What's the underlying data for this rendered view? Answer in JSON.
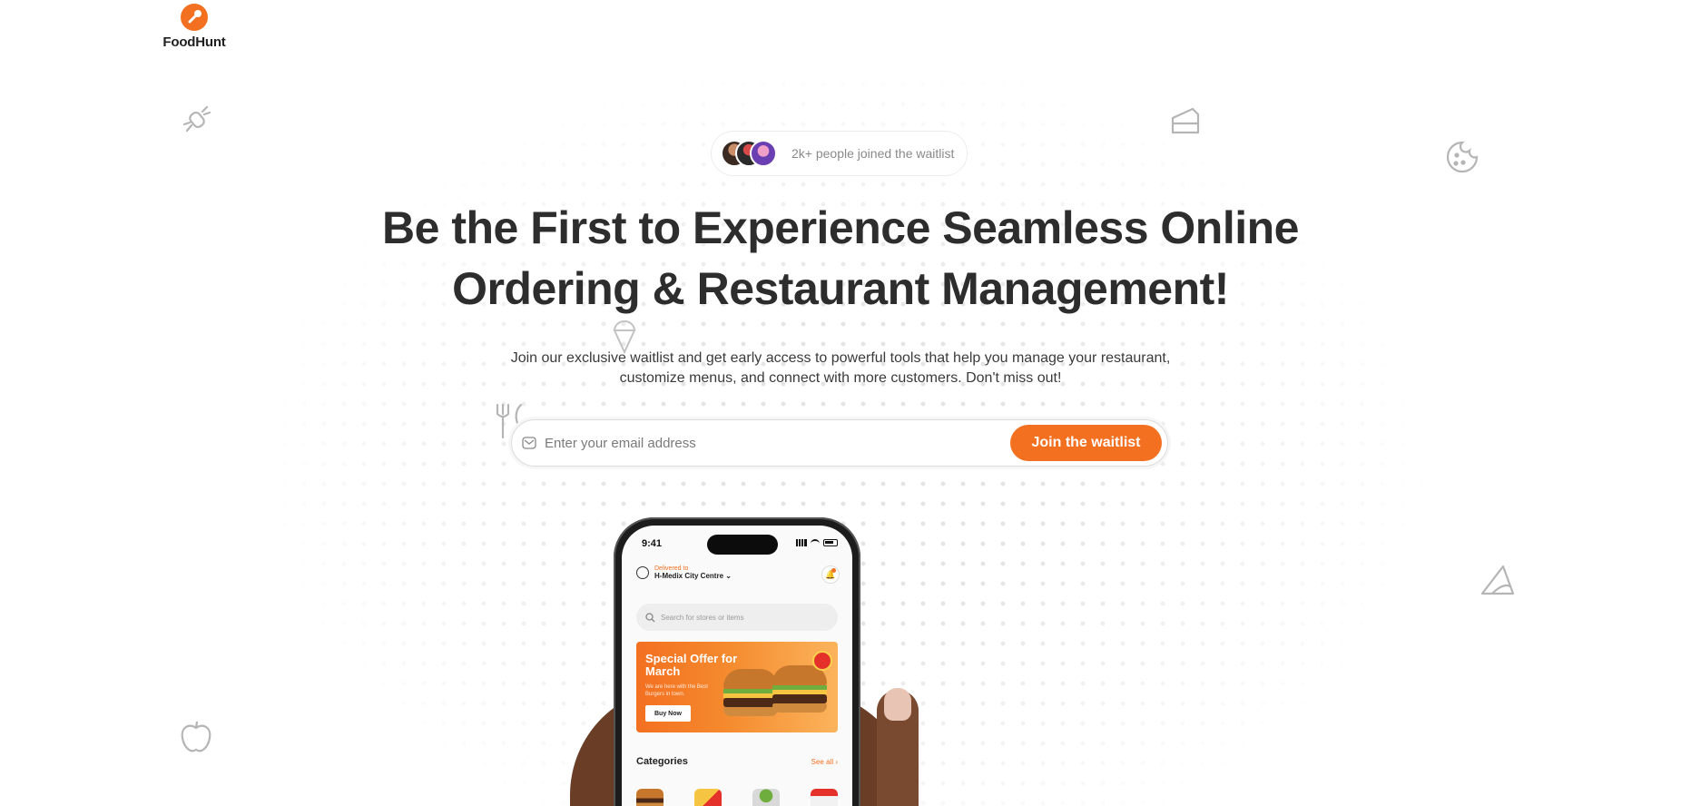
{
  "brand": {
    "name": "FoodHunt",
    "accent": "#f37021"
  },
  "waitlist_pill": {
    "text": "2k+ people joined the waitlist",
    "avatars": [
      "avatar-1",
      "avatar-2",
      "avatar-3"
    ]
  },
  "hero": {
    "headline": "Be the First to Experience Seamless Online Ordering & Restaurant Management!",
    "subtext": "Join our exclusive waitlist and get early access to powerful tools that help you manage your restaurant, customize menus, and connect with more customers. Don't miss out!"
  },
  "form": {
    "email_placeholder": "Enter your email address",
    "email_value": "",
    "button_label": "Join the waitlist"
  },
  "decor_icons": [
    "candy-icon",
    "cake-icon",
    "cookie-icon",
    "ice-cream-icon",
    "fork-knife-icon",
    "pizza-icon",
    "apple-icon"
  ],
  "phone": {
    "time": "9:41",
    "delivered_label": "Delivered to",
    "location": "H-Medix City Centre",
    "search_placeholder": "Search for stores or items",
    "promo": {
      "title": "Special Offer for March",
      "subtitle": "We are here with the Best Burgers in town.",
      "button": "Buy Now"
    },
    "categories_title": "Categories",
    "see_all": "See all"
  }
}
